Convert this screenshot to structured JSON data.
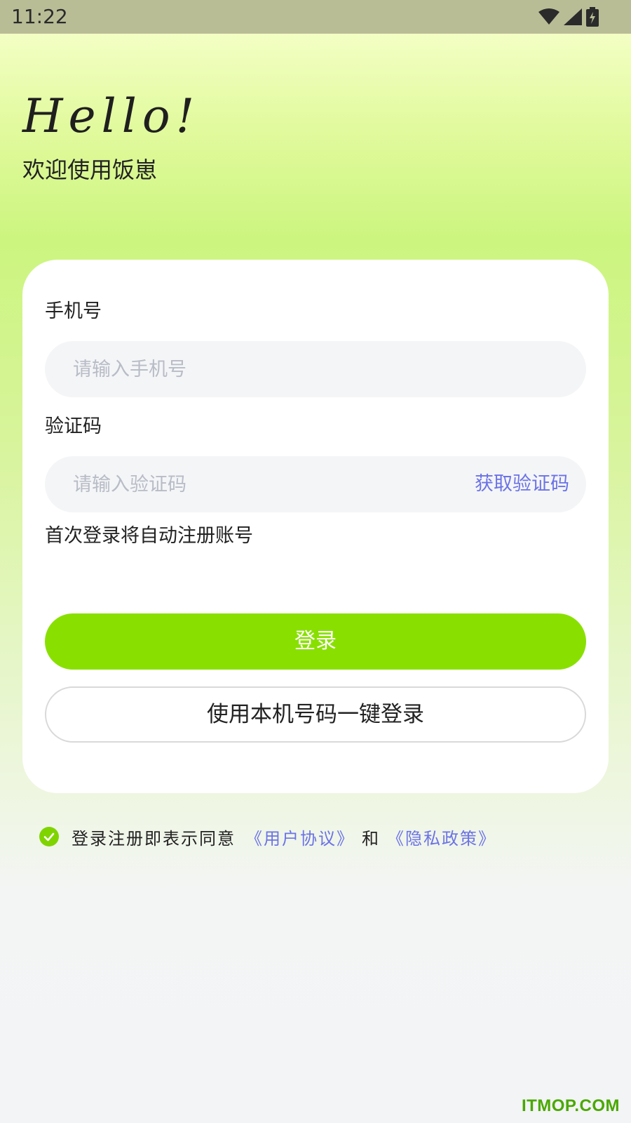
{
  "status_bar": {
    "time": "11:22",
    "icons": [
      "wifi-icon",
      "signal-icon",
      "battery-charging-icon"
    ]
  },
  "header": {
    "greeting": "Hello!",
    "welcome": "欢迎使用饭崽"
  },
  "form": {
    "phone_label": "手机号",
    "phone_placeholder": "请输入手机号",
    "phone_value": "",
    "code_label": "验证码",
    "code_placeholder": "请输入验证码",
    "code_value": "",
    "get_code_label": "获取验证码",
    "auto_register_note": "首次登录将自动注册账号",
    "login_label": "登录",
    "one_key_label": "使用本机号码一键登录"
  },
  "agreement": {
    "checked": true,
    "prefix": "登录注册即表示同意",
    "user_agreement": "《用户协议》",
    "and_text": "和",
    "privacy_policy": "《隐私政策》"
  },
  "watermark": "ITMOP.COM",
  "colors": {
    "accent_green": "#89e000",
    "link_blue": "#6b73e6",
    "status_bar": "#b9bd96"
  }
}
